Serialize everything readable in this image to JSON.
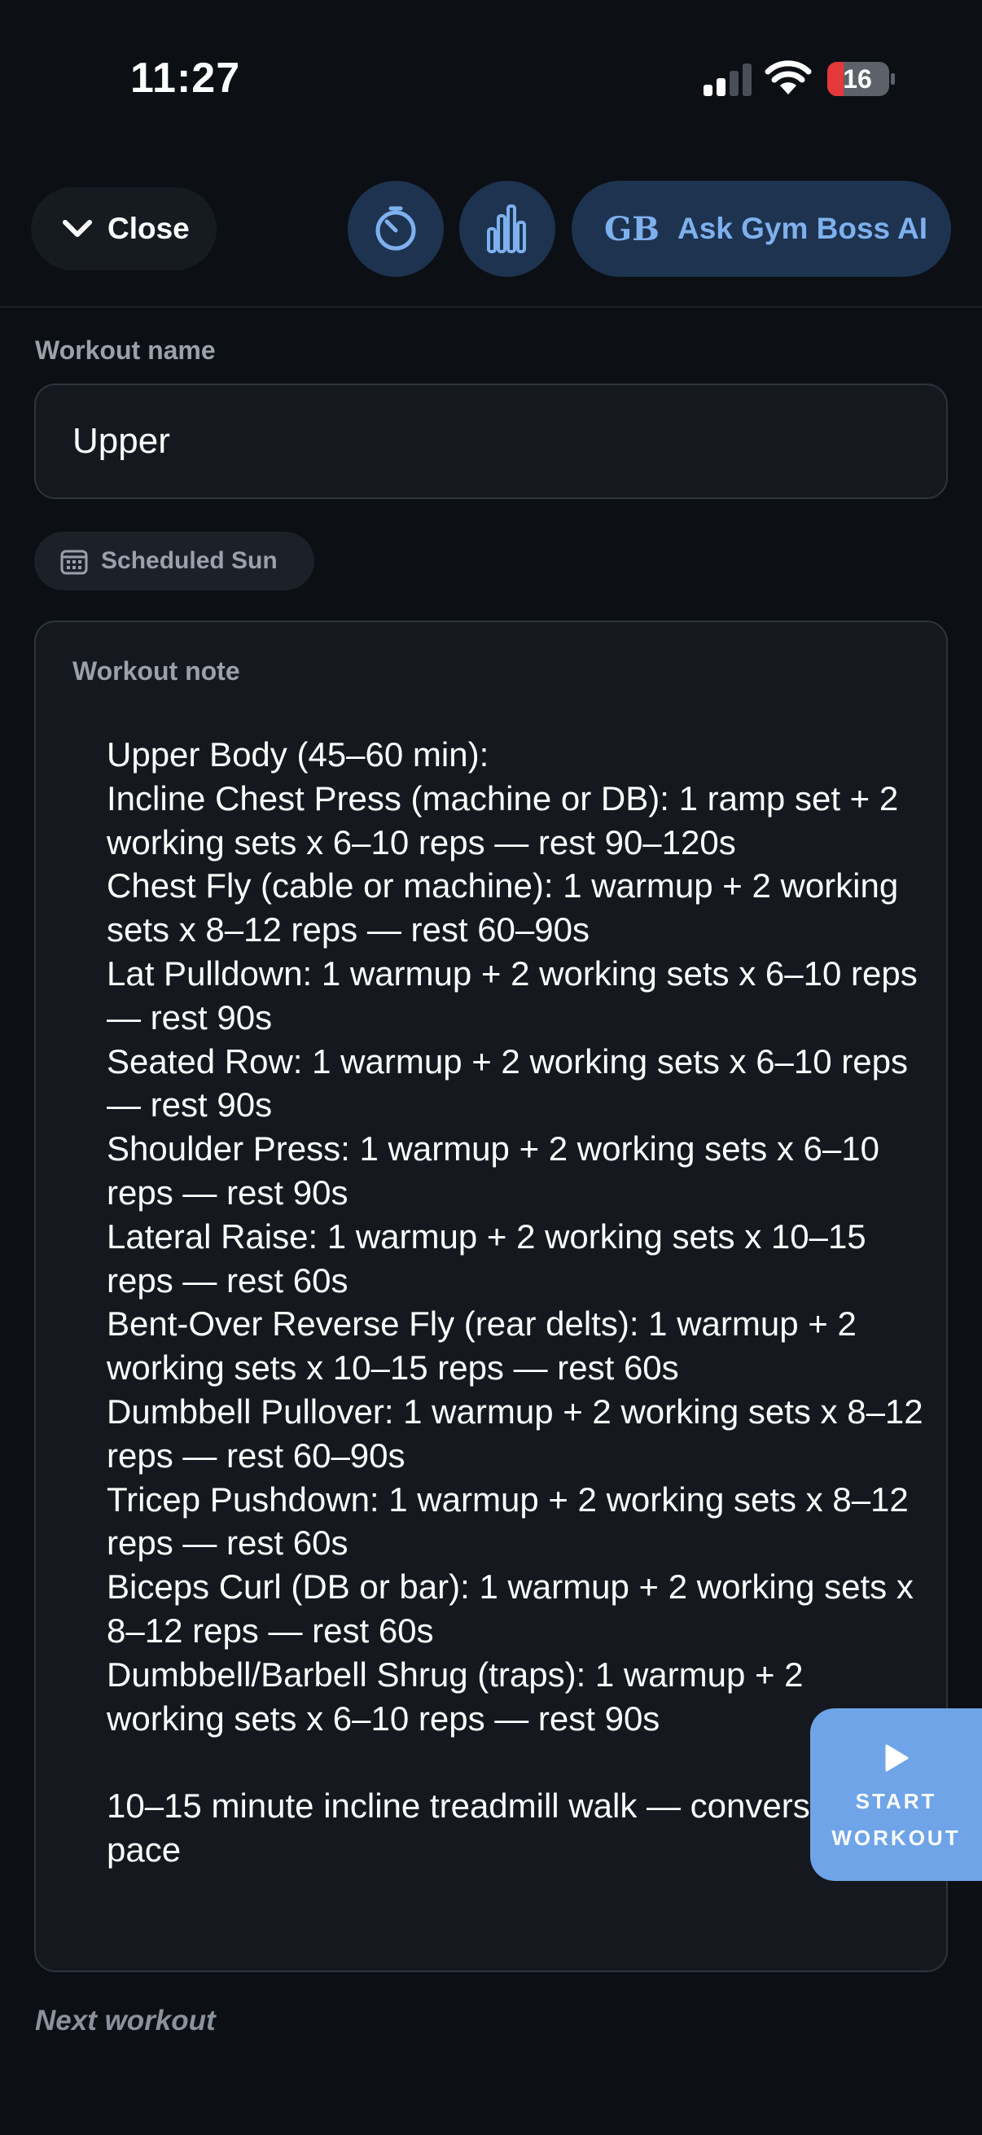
{
  "status_bar": {
    "time": "11:27",
    "battery": "16"
  },
  "header": {
    "close_label": "Close",
    "ask_logo": "GB",
    "ask_label": "Ask Gym Boss AI"
  },
  "workout_name": {
    "label": "Workout name",
    "value": "Upper"
  },
  "schedule": {
    "label": "Scheduled Sun"
  },
  "note": {
    "label": "Workout note",
    "text": "Upper Body (45–60 min):\nIncline Chest Press (machine or DB): 1 ramp set + 2 working sets x 6–10 reps — rest 90–120s\nChest Fly (cable or machine): 1 warmup + 2 working sets x 8–12 reps — rest 60–90s\nLat Pulldown: 1 warmup + 2 working sets x 6–10 reps — rest 90s\nSeated Row: 1 warmup + 2 working sets x 6–10 reps — rest 90s\nShoulder Press: 1 warmup + 2 working sets x 6–10 reps — rest 90s\nLateral Raise: 1 warmup + 2 working sets x 10–15 reps — rest 60s\nBent-Over Reverse Fly (rear delts): 1 warmup + 2 working sets x 10–15 reps — rest 60s\nDumbbell Pullover: 1 warmup + 2 working sets x 8–12 reps — rest 60–90s\nTricep Pushdown: 1 warmup + 2 working sets x 8–12 reps — rest 60s\nBiceps Curl (DB or bar): 1 warmup + 2 working sets x 8–12 reps — rest 60s\nDumbbell/Barbell Shrug (traps): 1 warmup + 2 working sets x 6–10 reps — rest 90s\n\n10–15 minute incline treadmill walk — conversational pace"
  },
  "next_workout_label": "Next workout",
  "start_button": {
    "line1": "START",
    "line2": "WORKOUT"
  },
  "icons": {
    "close": "chevron-down-icon",
    "timer": "timer-icon",
    "stats": "bar-chart-icon",
    "calendar": "calendar-icon",
    "play": "play-icon"
  },
  "colors": {
    "background": "#0c0f14",
    "accent": "#7fb0ee",
    "button_bg": "#1d3350",
    "start_bg": "#6fa4e8",
    "battery_low": "#e5383b"
  }
}
